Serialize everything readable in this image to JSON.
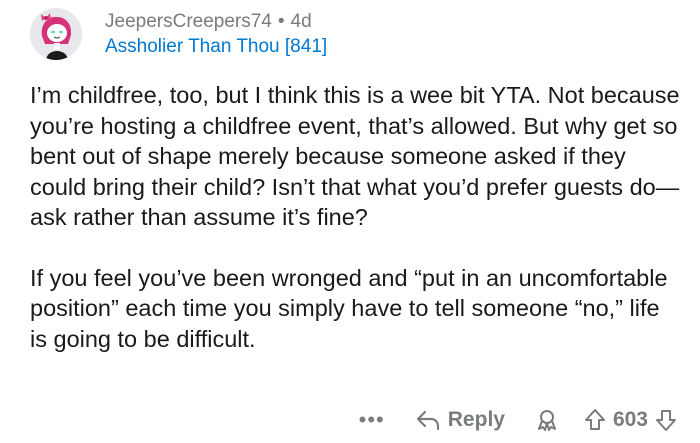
{
  "comment": {
    "username": "JeepersCreepers74",
    "separator": "•",
    "age": "4d",
    "flair": "Assholier Than Thou [841]",
    "avatar_icon": "user-avatar",
    "paragraphs": [
      "I’m childfree, too, but I think this is a wee bit YTA. Not because you’re hosting a childfree event, that’s allowed. But why get so bent out of shape merely because someone asked if they could bring their child?  Isn’t that what you’d prefer guests do—ask rather than assume it’s fine?",
      "If you feel you’ve been wronged and “put in an uncomfortable position” each time you simply have to tell someone “no,” life is going to be difficult."
    ]
  },
  "actions": {
    "more_label": "•••",
    "reply_label": "Reply",
    "score": "603",
    "icons": {
      "reply": "reply-arrow-icon",
      "award": "award-icon",
      "upvote": "upvote-arrow-icon",
      "downvote": "downvote-arrow-icon"
    }
  },
  "colors": {
    "text": "#1a1a1b",
    "meta": "#787c7e",
    "flair": "#0079d3"
  }
}
